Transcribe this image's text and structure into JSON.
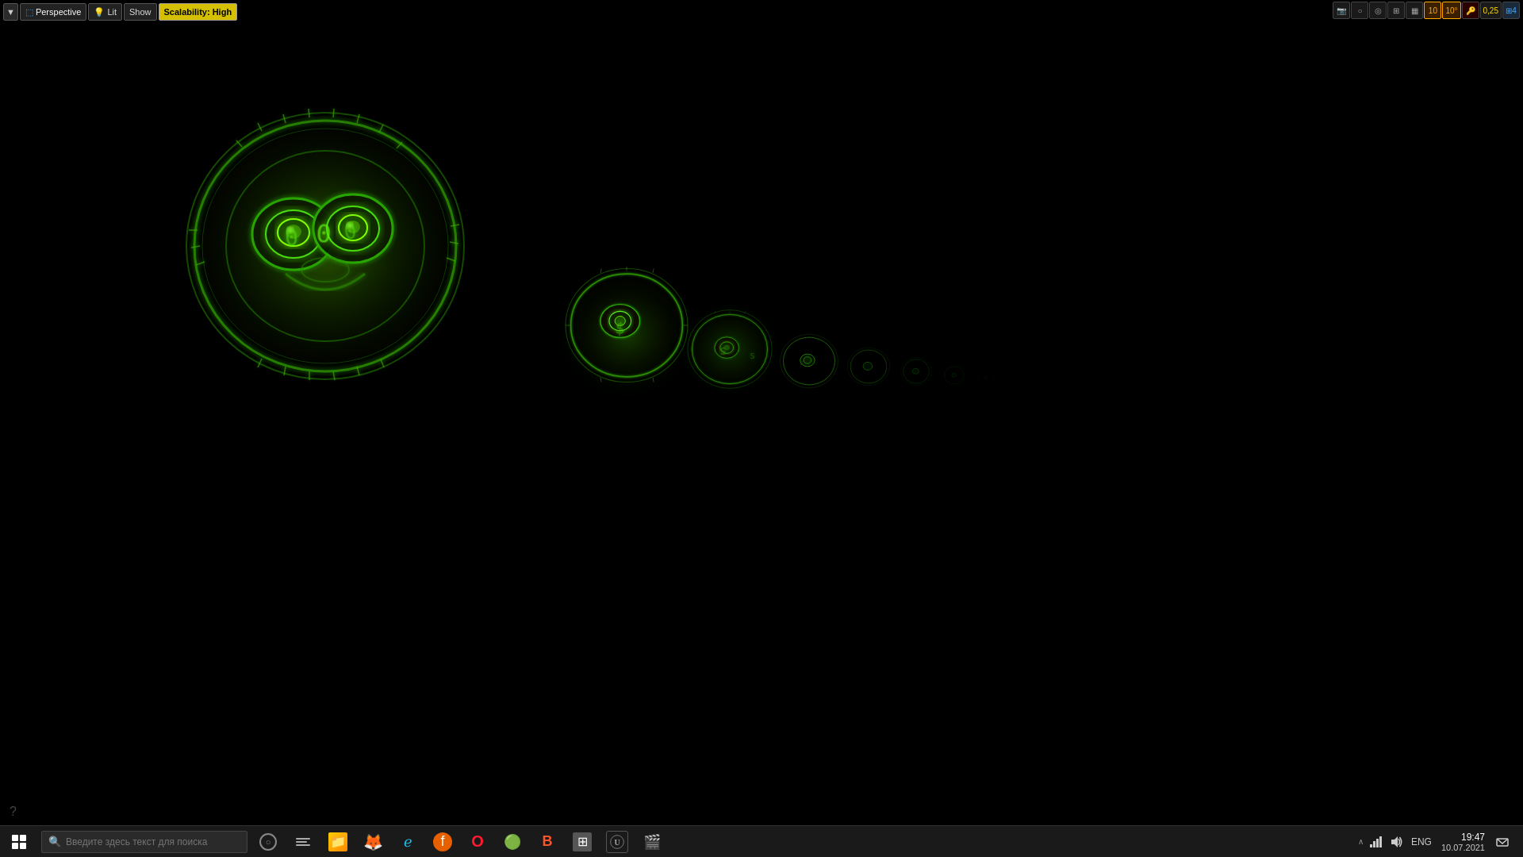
{
  "toolbar": {
    "perspective_label": "Perspective",
    "lit_label": "Lit",
    "show_label": "Show",
    "scalability_label": "Scalability: High"
  },
  "right_toolbar": {
    "icon1": "⬚",
    "icon2": "○",
    "icon3": "⊙",
    "icon4": "◈",
    "icon5": "▦",
    "grid_val": "10",
    "angle_val": "10°",
    "scale_val": "0,25",
    "layers_val": "4"
  },
  "taskbar": {
    "search_placeholder": "Введите здесь текст для поиска",
    "lang": "ENG",
    "time": "19:47",
    "date": "10.07.2021",
    "apps": [
      {
        "name": "windows-start",
        "label": "Пуск"
      },
      {
        "name": "cortana",
        "label": "Поиск"
      },
      {
        "name": "task-view",
        "label": "Представление задач"
      },
      {
        "name": "explorer",
        "label": "Проводник"
      },
      {
        "name": "firefox",
        "label": "Firefox"
      },
      {
        "name": "edge",
        "label": "Edge"
      },
      {
        "name": "firefox-alt",
        "label": "Firefox"
      },
      {
        "name": "opera",
        "label": "Opera"
      },
      {
        "name": "chrome",
        "label": "Chrome"
      },
      {
        "name": "brave",
        "label": "Brave"
      },
      {
        "name": "calculator",
        "label": "Калькулятор"
      },
      {
        "name": "unreal",
        "label": "Unreal Engine"
      },
      {
        "name": "film",
        "label": "Видео"
      }
    ]
  },
  "scene": {
    "description": "3D glowing green coin/token objects in perspective"
  }
}
